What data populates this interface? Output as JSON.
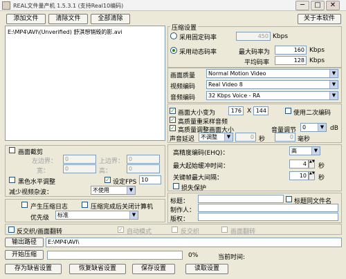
{
  "window": {
    "title": "REAL文件量产机 1.5.3.1 (支持Real10编码)",
    "min": "─",
    "max": "□",
    "close": "✕"
  },
  "toolbar": {
    "add": "添加文件",
    "remove": "清除文件",
    "clear_all": "全部清除",
    "about": "关于本软件"
  },
  "file_list": [
    "E:\\MP4\\AVI\\(Unverified) 舒淇想销毁的影.avi"
  ],
  "compress": {
    "group": "压缩设置",
    "fixed": "采用固定码率",
    "fixed_value": "450",
    "kbps": "Kbps",
    "dynamic": "采用动态码率",
    "max_label": "最大码率为",
    "max_value": "160",
    "avg_label": "平均码率",
    "avg_value": "128",
    "kbps2": "Kbps",
    "kbps3": "Kbps"
  },
  "codec": {
    "quality_label": "画面质量",
    "quality": "Normal Motion Video",
    "video_label": "视频编码",
    "video": "Real Video 8",
    "audio_label": "音频编码",
    "audio": "32 Kbps Voice - RA"
  },
  "resize": {
    "label": "画面大小变为",
    "w": "176",
    "x": "X",
    "h": "144",
    "second": "使用二次编码",
    "hq_resample": "高质量重采样音频",
    "hq_adjust": "高质量调整画面大小",
    "vol_label": "音量调节",
    "vol": "0",
    "db": "dB",
    "delay_label": "声音延迟",
    "delay_sel": "不调整",
    "sec": "秒",
    "ms": "毫秒",
    "delay_s": "0",
    "delay_ms": "0"
  },
  "crop": {
    "label": "画面截剪",
    "left": "左边界：",
    "top": "上边界：",
    "width": "宽：",
    "height": "高：",
    "v_left": "0",
    "v_top": "0",
    "v_width": "0",
    "v_height": "0",
    "bw": "黑色水平调整",
    "fps_label": "设定FPS",
    "fps": "10",
    "noise_label": "减少视频杂波：",
    "noise": "不使用"
  },
  "adv": {
    "hq_label": "高精度编码(EHQ)：",
    "hq": "高",
    "buffer_label": "最大起始缓冲时间：",
    "buffer": "4",
    "buffer_unit": "秒",
    "keyframe_label": "关键帧最大间隔：",
    "keyframe": "10",
    "keyframe_unit": "秒",
    "protect": "损失保护"
  },
  "log": {
    "gen_log": "产生压缩日志",
    "stats": "压缩完成后关闭计算机",
    "priority_label": "优先级",
    "priority": "标准"
  },
  "meta": {
    "title_label": "标题：",
    "title": "",
    "title_as_name": "标题同文件名",
    "author_label": "制作人：",
    "author": "",
    "copyright_label": "版权：",
    "copyright": ""
  },
  "bottom": {
    "deinterlace": "反交织/画面翻转",
    "auto": "自动模式",
    "anti": "反交织",
    "flip": "画面翻转",
    "output_btn": "输出路径",
    "output_path": "E:\\MP4\\AVI\\",
    "start_btn": "开始压缩",
    "percent": "0%",
    "time_label": "当前时间:",
    "time": "",
    "progress": 0.0,
    "save_default": "存为缺省设置",
    "restore_default": "恢复缺省设置",
    "save": "保存设置",
    "load": "读取设置"
  }
}
